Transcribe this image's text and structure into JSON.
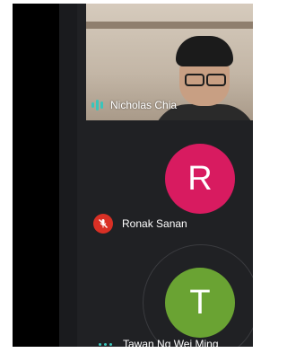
{
  "participants": [
    {
      "name": "Nicholas Chia",
      "status": "speaking",
      "tile": "video"
    },
    {
      "name": "Ronak Sanan",
      "initial": "R",
      "status": "muted",
      "avatar_color": "#d81b60"
    },
    {
      "name": "Tawan Ng Wei Ming",
      "initial": "T",
      "status": "speaking-dots",
      "avatar_color": "#6aa333"
    }
  ],
  "colors": {
    "background": "#202124",
    "speaking_indicator": "#39c5bb",
    "muted_badge": "#d93025"
  },
  "icons": {
    "speaking": "audio-bars-icon",
    "muted": "mic-off-icon",
    "listening": "three-dots-icon"
  }
}
